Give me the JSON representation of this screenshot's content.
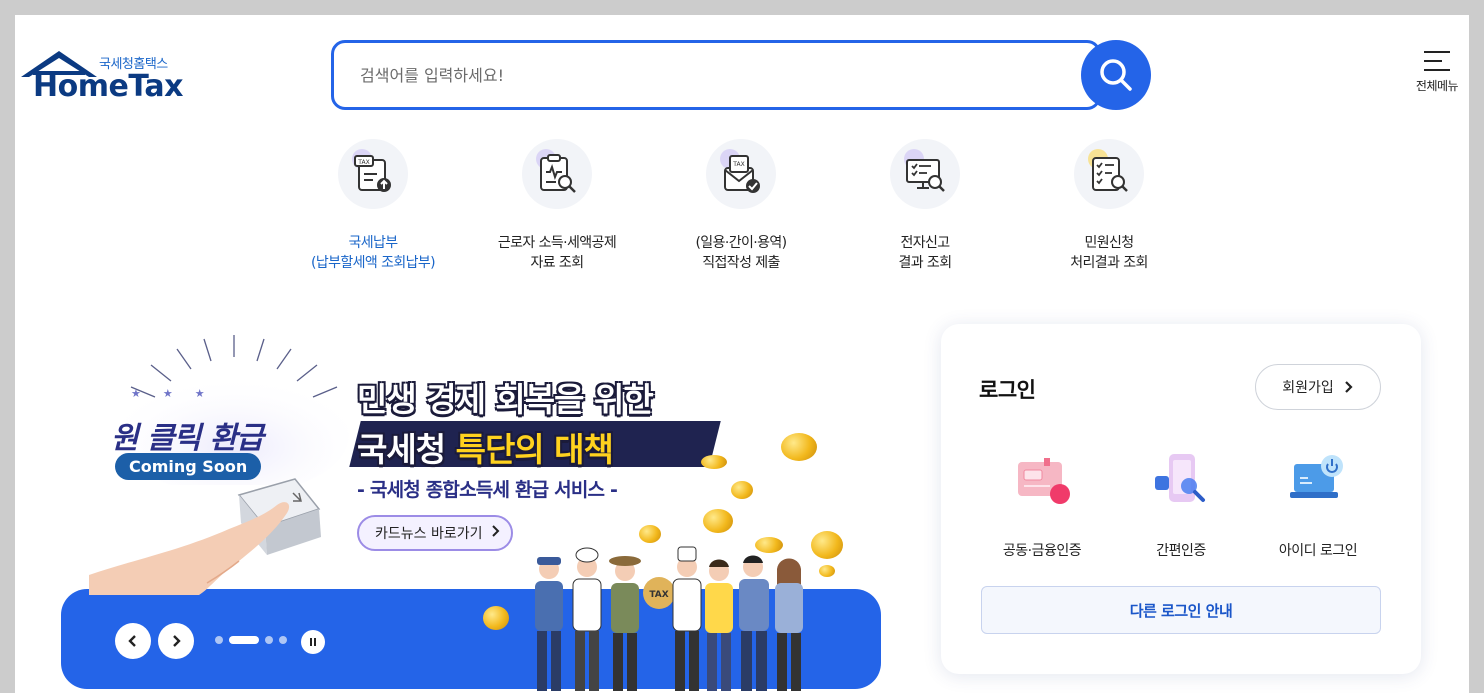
{
  "header": {
    "logo_sub": "국세청홈택스",
    "logo_main": "HomeTax",
    "search_placeholder": "검색어를 입력하세요!",
    "allmenu_label": "전체메뉴"
  },
  "quick_menu": [
    {
      "line1": "국세납부",
      "line2": "(납부할세액 조회납부)",
      "icon": "tax-upload-icon"
    },
    {
      "line1": "근로자 소득·세액공제",
      "line2": "자료 조회",
      "icon": "document-search-icon"
    },
    {
      "line1": "(일용·간이·용역)",
      "line2": "직접작성 제출",
      "icon": "tax-envelope-check-icon"
    },
    {
      "line1": "전자신고",
      "line2": "결과 조회",
      "icon": "monitor-search-icon"
    },
    {
      "line1": "민원신청",
      "line2": "처리결과 조회",
      "icon": "checklist-search-icon"
    }
  ],
  "banner": {
    "oneclick": "원 클릭 환급",
    "coming_soon": "Coming Soon",
    "headline1": "민생 경제 회복을 위한",
    "headline2_a": "국세청 ",
    "headline2_b": "특단의 대책",
    "subtitle": "- 국세청 종합소득세 환급 서비스 -",
    "cardnews_label": "카드뉴스 바로가기",
    "tax_bag": "TAX",
    "slides_total": 4,
    "slide_current": 2
  },
  "login": {
    "title": "로그인",
    "join_label": "회원가입",
    "options": [
      {
        "label": "공동·금융인증",
        "icon": "certificate-icon"
      },
      {
        "label": "간편인증",
        "icon": "phone-search-icon"
      },
      {
        "label": "아이디 로그인",
        "icon": "laptop-power-icon"
      }
    ],
    "other_label": "다른 로그인 안내"
  },
  "colors": {
    "primary": "#2464e8",
    "navy": "#0b3a82",
    "link_blue": "#1a66c9",
    "headline_yellow": "#ffd21e"
  }
}
